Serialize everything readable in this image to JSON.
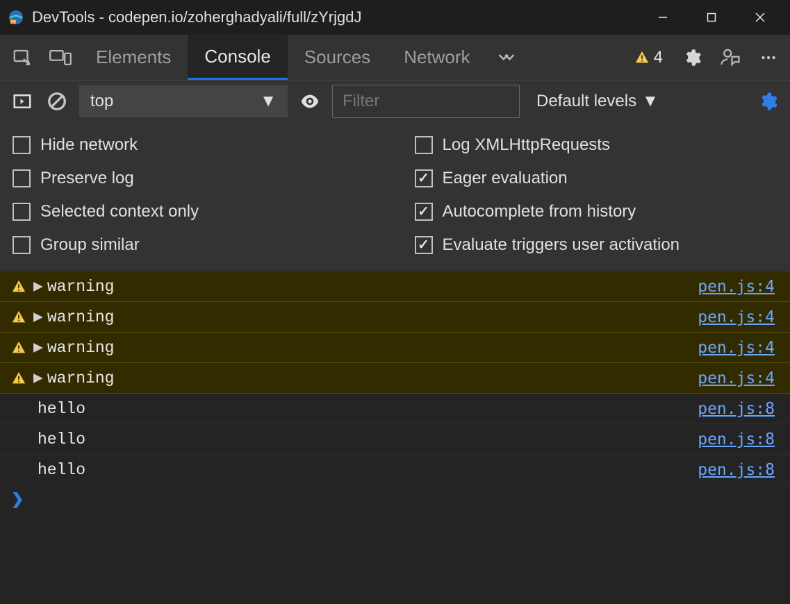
{
  "titlebar": {
    "title": "DevTools - codepen.io/zoherghadyali/full/zYrjgdJ"
  },
  "tabs": {
    "items": [
      "Elements",
      "Console",
      "Sources",
      "Network"
    ],
    "active_index": 1,
    "warning_count": "4"
  },
  "filterbar": {
    "context": "top",
    "filter_placeholder": "Filter",
    "levels_label": "Default levels"
  },
  "options": [
    {
      "label": "Hide network",
      "checked": false
    },
    {
      "label": "Log XMLHttpRequests",
      "checked": false
    },
    {
      "label": "Preserve log",
      "checked": false
    },
    {
      "label": "Eager evaluation",
      "checked": true
    },
    {
      "label": "Selected context only",
      "checked": false
    },
    {
      "label": "Autocomplete from history",
      "checked": true
    },
    {
      "label": "Group similar",
      "checked": false
    },
    {
      "label": "Evaluate triggers user activation",
      "checked": true
    }
  ],
  "logs": [
    {
      "type": "warn",
      "expandable": true,
      "message": "warning",
      "source": "pen.js:4"
    },
    {
      "type": "warn",
      "expandable": true,
      "message": "warning",
      "source": "pen.js:4"
    },
    {
      "type": "warn",
      "expandable": true,
      "message": "warning",
      "source": "pen.js:4"
    },
    {
      "type": "warn",
      "expandable": true,
      "message": "warning",
      "source": "pen.js:4"
    },
    {
      "type": "log",
      "expandable": false,
      "message": "hello",
      "source": "pen.js:8"
    },
    {
      "type": "log",
      "expandable": false,
      "message": "hello",
      "source": "pen.js:8"
    },
    {
      "type": "log",
      "expandable": false,
      "message": "hello",
      "source": "pen.js:8"
    }
  ]
}
